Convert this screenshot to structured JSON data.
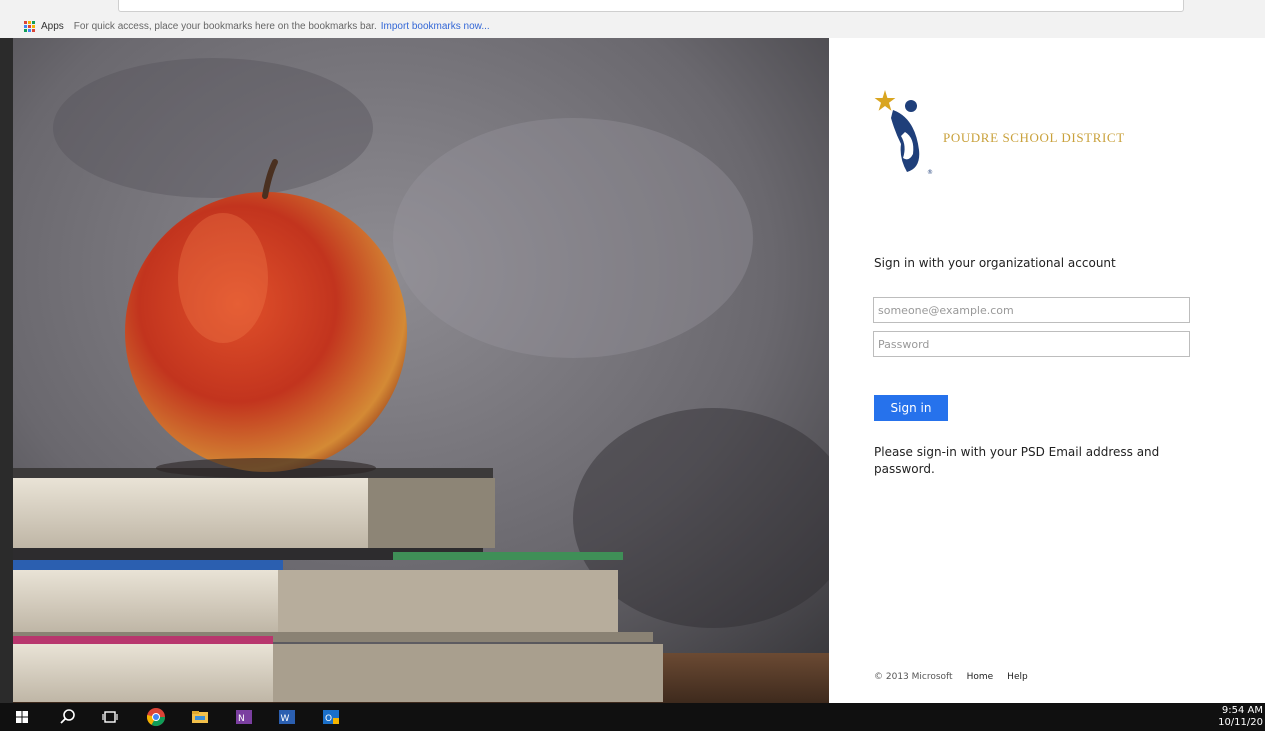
{
  "browser": {
    "apps_label": "Apps",
    "bookmarks_hint": "For quick access, place your bookmarks here on the bookmarks bar.",
    "import_link": "Import bookmarks now..."
  },
  "login": {
    "district_name": "POUDRE SCHOOL DISTRICT",
    "heading": "Sign in with your organizational account",
    "email_placeholder": "someone@example.com",
    "password_placeholder": "Password",
    "signin_label": "Sign in",
    "help_text": "Please sign-in with your PSD Email address and password.",
    "footer": {
      "copyright": "© 2013 Microsoft",
      "home": "Home",
      "help": "Help"
    },
    "colors": {
      "accent": "#2672ec",
      "brand_gold": "#c9a13b",
      "brand_navy": "#1f3f7a"
    }
  },
  "taskbar": {
    "icons": [
      "windows-start-icon",
      "search-icon",
      "task-view-icon",
      "chrome-icon",
      "file-explorer-icon",
      "onenote-icon",
      "word-icon",
      "outlook-icon"
    ],
    "clock_time": "9:54 AM",
    "clock_date": "10/11/20"
  }
}
